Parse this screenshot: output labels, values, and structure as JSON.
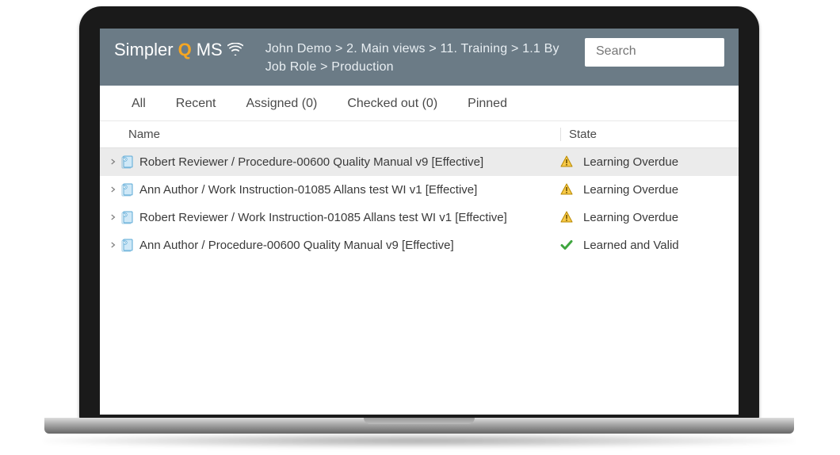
{
  "logo": {
    "prefix": "Simpler",
    "accent": "Q",
    "suffix": "MS"
  },
  "breadcrumb": "John Demo > 2. Main views > 11. Training > 1.1 By Job Role > Production",
  "search": {
    "placeholder": "Search"
  },
  "tabs": {
    "all": "All",
    "recent": "Recent",
    "assigned": "Assigned (0)",
    "checked_out": "Checked out (0)",
    "pinned": "Pinned"
  },
  "columns": {
    "name": "Name",
    "state": "State"
  },
  "rows": [
    {
      "name": "Robert Reviewer / Procedure-00600 Quality Manual v9 [Effective]",
      "state": "Learning Overdue",
      "icon": "warning",
      "selected": true
    },
    {
      "name": "Ann Author / Work Instruction-01085 Allans test WI v1 [Effective]",
      "state": "Learning Overdue",
      "icon": "warning",
      "selected": false
    },
    {
      "name": "Robert Reviewer / Work Instruction-01085 Allans test WI v1 [Effective]",
      "state": "Learning Overdue",
      "icon": "warning",
      "selected": false
    },
    {
      "name": "Ann Author / Procedure-00600 Quality Manual v9 [Effective]",
      "state": "Learned and Valid",
      "icon": "check",
      "selected": false
    }
  ]
}
